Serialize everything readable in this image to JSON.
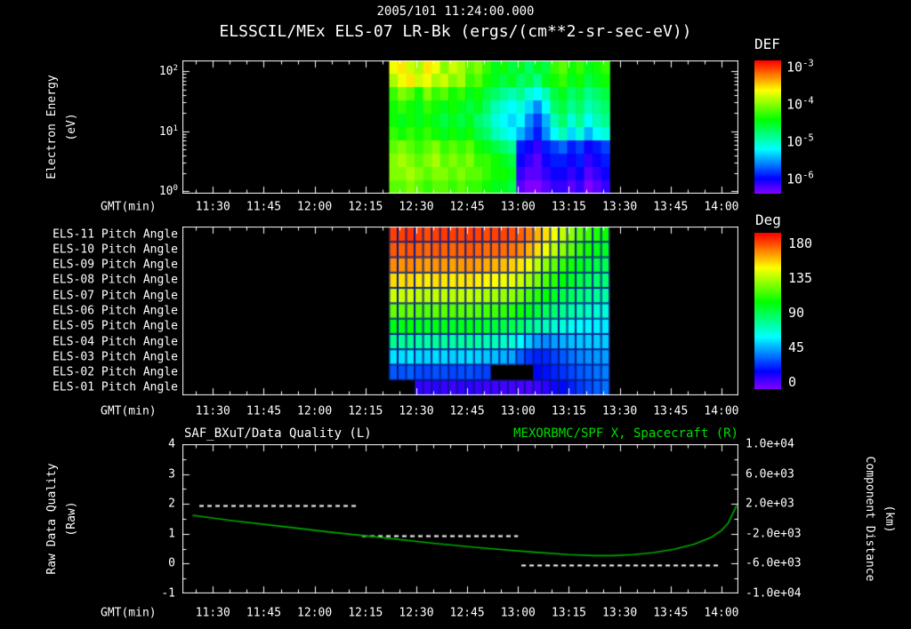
{
  "header": {
    "title": "2005/101 11:24:00.000",
    "subtitle": "ELSSCIL/MEx ELS-07 LR-Bk (ergs/(cm**2-sr-sec-eV))"
  },
  "colors": {
    "background": "#000000",
    "text": "#ffffff",
    "title_green": "#00dd00",
    "curve_green": "#00aa00",
    "quality_white": "#ffffff",
    "cell_grid": "#001a8c"
  },
  "time_axis": {
    "label": "GMT(min)",
    "tick_labels": [
      "11:30",
      "11:45",
      "12:00",
      "12:15",
      "12:30",
      "12:45",
      "13:00",
      "13:15",
      "13:30",
      "13:45",
      "14:00"
    ],
    "tick_minutes": [
      690,
      705,
      720,
      735,
      750,
      765,
      780,
      795,
      810,
      825,
      840
    ],
    "range_minutes": [
      681,
      845
    ]
  },
  "panel1": {
    "ylabel_lines": [
      "Electron Energy",
      "(eV)"
    ],
    "ytick_exponents": [
      "2",
      "1",
      "0"
    ]
  },
  "colorbars": {
    "def": {
      "title": "DEF",
      "tick_exponents": [
        "-3",
        "-4",
        "-5",
        "-6"
      ]
    },
    "deg": {
      "title": "Deg",
      "tick_labels": [
        "180",
        "135",
        "90",
        "45",
        "0"
      ]
    }
  },
  "panel2": {
    "row_labels": [
      "ELS-11 Pitch Angle",
      "ELS-10 Pitch Angle",
      "ELS-09 Pitch Angle",
      "ELS-08 Pitch Angle",
      "ELS-07 Pitch Angle",
      "ELS-06 Pitch Angle",
      "ELS-05 Pitch Angle",
      "ELS-04 Pitch Angle",
      "ELS-03 Pitch Angle",
      "ELS-02 Pitch Angle",
      "ELS-01 Pitch Angle"
    ]
  },
  "panel3": {
    "left_title": "SAF_BXuT/Data Quality (L)",
    "right_title": "MEXORBMC/SPF X, Spacecraft (R)",
    "left_tick_labels": [
      "4",
      "3",
      "2",
      "1",
      "0",
      "-1"
    ],
    "right_tick_labels": [
      "1.0e+04",
      "6.0e+03",
      "2.0e+03",
      "-2.0e+03",
      "-6.0e+03",
      "-1.0e+04"
    ],
    "left_label_lines": [
      "Raw Data Quality",
      "(Raw)"
    ],
    "right_label_lines": [
      "Component Distance",
      "(km)"
    ]
  },
  "chart_data": [
    {
      "type": "heatmap",
      "name": "electron-energy-spectrogram",
      "title": "ELSSCIL/MEx ELS-07 LR-Bk",
      "units": "ergs/(cm**2-sr-sec-eV)",
      "x_axis": "GMT minutes of day",
      "x_start_min": 742,
      "x_col_min": 2.5,
      "y_axis": "Electron Energy (eV), log scale",
      "ylim": [
        1,
        150
      ],
      "y_log10_range": [
        -0.04,
        2.18
      ],
      "z_axis": "log10 DEF",
      "zlim_log10": [
        -6,
        -3
      ],
      "rows_top_to_bottom_log10_def": [
        [
          -3.7,
          -3.6,
          -3.8,
          -3.9,
          -3.6,
          -3.7,
          -4.0,
          -3.8,
          -3.9,
          -4.1,
          -4.0,
          -4.2,
          -4.4,
          -4.3,
          -4.5,
          -4.4,
          -4.6,
          -4.4,
          -4.5,
          -4.2,
          -4.1,
          -4.3,
          -4.2,
          -4.4,
          -4.3,
          -4.2
        ],
        [
          -3.9,
          -3.7,
          -3.6,
          -3.8,
          -3.7,
          -3.9,
          -3.8,
          -4.0,
          -3.9,
          -4.2,
          -4.1,
          -4.3,
          -4.4,
          -4.5,
          -4.4,
          -4.6,
          -4.5,
          -4.7,
          -4.4,
          -4.3,
          -4.2,
          -4.4,
          -4.3,
          -4.5,
          -4.4,
          -4.3
        ],
        [
          -4.2,
          -4.0,
          -4.1,
          -4.3,
          -4.0,
          -4.2,
          -4.1,
          -4.3,
          -4.2,
          -4.4,
          -4.3,
          -4.5,
          -4.6,
          -4.7,
          -4.8,
          -4.7,
          -4.9,
          -5.0,
          -4.8,
          -4.5,
          -4.4,
          -4.6,
          -4.5,
          -4.7,
          -4.6,
          -4.5
        ],
        [
          -4.3,
          -4.2,
          -4.3,
          -4.4,
          -4.2,
          -4.3,
          -4.4,
          -4.3,
          -4.4,
          -4.5,
          -4.4,
          -4.6,
          -4.8,
          -4.9,
          -5.0,
          -4.9,
          -5.1,
          -5.3,
          -5.0,
          -4.6,
          -4.5,
          -4.7,
          -4.6,
          -4.8,
          -4.7,
          -4.6
        ],
        [
          -4.3,
          -4.4,
          -4.3,
          -4.4,
          -4.3,
          -4.4,
          -4.5,
          -4.4,
          -4.5,
          -4.4,
          -4.6,
          -4.7,
          -4.9,
          -5.0,
          -5.1,
          -5.0,
          -5.3,
          -5.5,
          -5.2,
          -4.8,
          -4.6,
          -4.9,
          -4.7,
          -5.0,
          -4.8,
          -4.7
        ],
        [
          -4.2,
          -4.3,
          -4.2,
          -4.3,
          -4.2,
          -4.3,
          -4.4,
          -4.3,
          -4.4,
          -4.3,
          -4.5,
          -4.6,
          -4.8,
          -4.9,
          -5.0,
          -5.2,
          -5.4,
          -5.6,
          -5.3,
          -5.0,
          -4.8,
          -5.1,
          -4.9,
          -5.2,
          -5.0,
          -4.9
        ],
        [
          -4.1,
          -4.0,
          -4.1,
          -4.2,
          -4.1,
          -4.0,
          -4.2,
          -4.1,
          -4.2,
          -4.1,
          -4.3,
          -4.4,
          -4.5,
          -4.6,
          -4.7,
          -5.6,
          -5.7,
          -5.8,
          -5.6,
          -5.5,
          -5.4,
          -5.6,
          -5.5,
          -5.7,
          -5.6,
          -5.5
        ],
        [
          -4.0,
          -3.9,
          -4.0,
          -4.1,
          -4.0,
          -3.9,
          -4.1,
          -4.0,
          -4.1,
          -4.0,
          -4.2,
          -4.2,
          -4.3,
          -4.4,
          -4.5,
          -5.7,
          -5.8,
          -5.9,
          -5.7,
          -5.6,
          -5.6,
          -5.7,
          -5.6,
          -5.8,
          -5.7,
          -5.6
        ],
        [
          -4.0,
          -4.0,
          -3.9,
          -4.0,
          -4.1,
          -4.0,
          -4.0,
          -4.1,
          -4.0,
          -4.1,
          -4.1,
          -4.2,
          -4.3,
          -4.3,
          -4.4,
          -5.8,
          -5.9,
          -5.9,
          -5.8,
          -5.7,
          -5.7,
          -5.8,
          -5.7,
          -5.9,
          -5.8,
          -5.7
        ],
        [
          -4.1,
          -4.1,
          -4.0,
          -4.1,
          -4.2,
          -4.1,
          -4.1,
          -4.2,
          -4.1,
          -4.2,
          -4.2,
          -4.3,
          -4.4,
          -4.4,
          -4.5,
          -5.9,
          -6.0,
          -6.0,
          -5.9,
          -5.8,
          -5.8,
          -5.9,
          -5.8,
          -6.0,
          -5.9,
          -5.8
        ]
      ]
    },
    {
      "type": "heatmap",
      "name": "pitch-angle-grid",
      "x_start_min": 742,
      "x_col_min": 2.5,
      "z_axis": "Pitch angle (deg)",
      "zlim": [
        0,
        180
      ],
      "rows": [
        {
          "label": "ELS-11 Pitch Angle",
          "values": [
            170,
            170,
            172,
            170,
            168,
            170,
            171,
            170,
            169,
            170,
            170,
            168,
            170,
            169,
            168,
            165,
            160,
            152,
            145,
            138,
            130,
            122,
            115,
            110,
            105,
            102
          ]
        },
        {
          "label": "ELS-10 Pitch Angle",
          "values": [
            166,
            165,
            167,
            165,
            164,
            166,
            165,
            164,
            165,
            166,
            165,
            163,
            164,
            163,
            162,
            158,
            152,
            145,
            138,
            130,
            122,
            115,
            108,
            103,
            98,
            95
          ]
        },
        {
          "label": "ELS-09 Pitch Angle",
          "values": [
            158,
            157,
            159,
            156,
            155,
            157,
            156,
            155,
            156,
            157,
            155,
            153,
            152,
            150,
            148,
            144,
            138,
            130,
            122,
            115,
            108,
            102,
            97,
            93,
            90,
            88
          ]
        },
        {
          "label": "ELS-08 Pitch Angle",
          "values": [
            146,
            145,
            147,
            144,
            143,
            145,
            144,
            143,
            144,
            145,
            143,
            141,
            140,
            138,
            136,
            132,
            126,
            119,
            112,
            106,
            100,
            95,
            90,
            87,
            84,
            82
          ]
        },
        {
          "label": "ELS-07 Pitch Angle",
          "values": [
            132,
            131,
            133,
            130,
            129,
            131,
            130,
            129,
            130,
            131,
            129,
            127,
            126,
            124,
            122,
            118,
            112,
            106,
            100,
            95,
            90,
            86,
            82,
            79,
            77,
            75
          ]
        },
        {
          "label": "ELS-06 Pitch Angle",
          "values": [
            116,
            115,
            117,
            114,
            113,
            115,
            114,
            113,
            114,
            115,
            113,
            111,
            110,
            108,
            106,
            102,
            97,
            92,
            87,
            83,
            79,
            76,
            73,
            70,
            68,
            67
          ]
        },
        {
          "label": "ELS-05 Pitch Angle",
          "values": [
            98,
            97,
            99,
            96,
            95,
            97,
            96,
            95,
            96,
            97,
            95,
            93,
            92,
            90,
            88,
            85,
            80,
            76,
            72,
            69,
            66,
            63,
            61,
            59,
            58,
            57
          ]
        },
        {
          "label": "ELS-04 Pitch Angle",
          "values": [
            78,
            77,
            79,
            76,
            75,
            77,
            76,
            75,
            76,
            77,
            75,
            73,
            72,
            70,
            68,
            60,
            52,
            45,
            42,
            45,
            48,
            50,
            51,
            52,
            52,
            52
          ]
        },
        {
          "label": "ELS-03 Pitch Angle",
          "values": [
            56,
            55,
            57,
            54,
            53,
            55,
            54,
            53,
            54,
            55,
            53,
            51,
            50,
            48,
            46,
            35,
            28,
            25,
            26,
            30,
            34,
            38,
            41,
            43,
            44,
            45
          ]
        },
        {
          "label": "ELS-02 Pitch Angle",
          "values": [
            34,
            33,
            35,
            32,
            31,
            33,
            32,
            31,
            32,
            33,
            31,
            30,
            null,
            null,
            null,
            null,
            null,
            20,
            22,
            25,
            28,
            31,
            34,
            36,
            38,
            40
          ]
        },
        {
          "label": "ELS-01 Pitch Angle",
          "values": [
            null,
            null,
            null,
            12,
            11,
            13,
            11,
            10,
            12,
            13,
            11,
            10,
            10,
            9,
            9,
            8,
            8,
            10,
            13,
            17,
            21,
            25,
            29,
            32,
            35,
            38
          ]
        }
      ]
    },
    {
      "type": "line",
      "name": "quality-and-spacecraft-distance",
      "left_axis": {
        "label": "Raw Data Quality (Raw)",
        "ylim": [
          -1,
          4
        ]
      },
      "right_axis": {
        "label": "Component Distance (km)",
        "ylim": [
          -10000,
          10000
        ]
      },
      "series": [
        {
          "name": "SAF_BXuT/Data Quality (L)",
          "axis": "left",
          "style": "dashed",
          "color": "#ffffff",
          "segments": [
            {
              "t_min": [
                686,
                733
              ],
              "value": 2
            },
            {
              "t_min": [
                734,
                780
              ],
              "value": 1
            },
            {
              "t_min": [
                781,
                839
              ],
              "value": 0
            }
          ]
        },
        {
          "name": "MEXORBMC/SPF X, Spacecraft (R)",
          "axis": "right",
          "style": "solid",
          "color": "#00aa00",
          "t_min": [
            684,
            695,
            710,
            725,
            740,
            755,
            770,
            785,
            795,
            802,
            808,
            814,
            820,
            826,
            832,
            837,
            840,
            842,
            844.5
          ],
          "km": [
            480,
            -200,
            -1000,
            -1800,
            -2520,
            -3280,
            -3920,
            -4480,
            -4800,
            -4920,
            -4920,
            -4800,
            -4520,
            -4080,
            -3400,
            -2480,
            -1560,
            -560,
            1800
          ]
        }
      ]
    }
  ]
}
